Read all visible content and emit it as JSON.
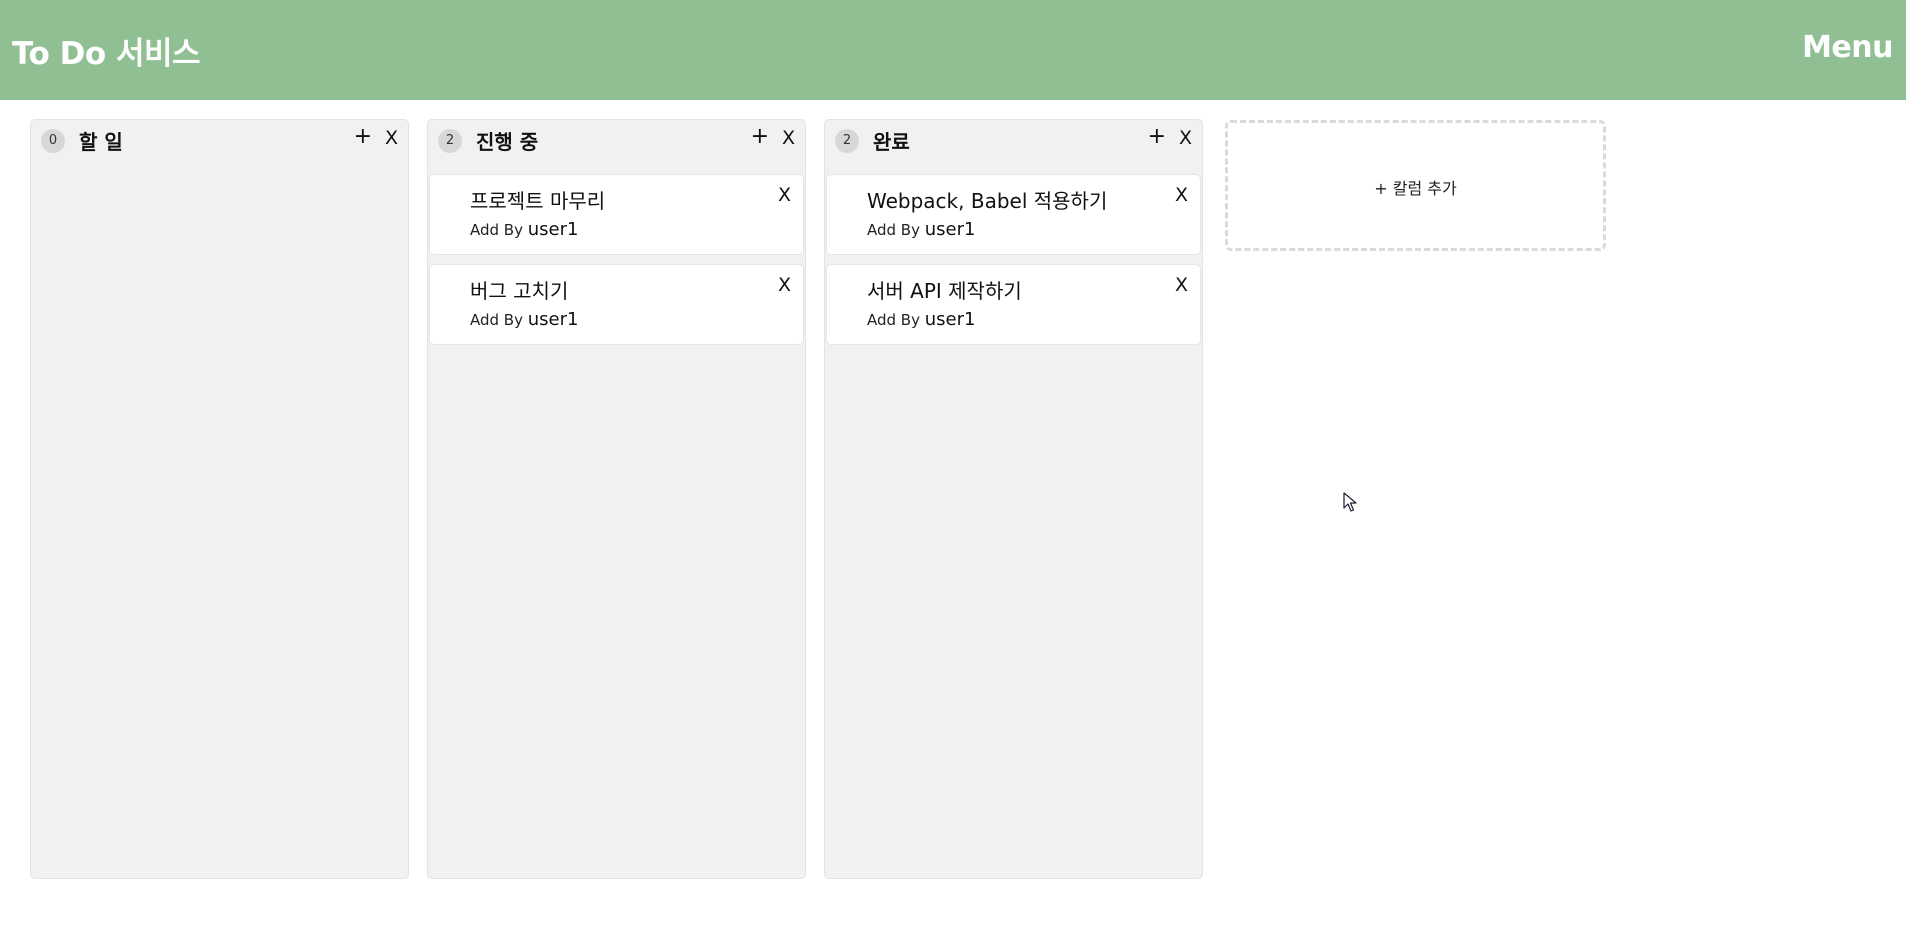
{
  "header": {
    "title": "To Do 서비스",
    "menu_label": "Menu",
    "background_color": "#91bf94"
  },
  "columns": [
    {
      "title": "할 일",
      "count": "0",
      "add_label": "+",
      "close_label": "X",
      "cards": []
    },
    {
      "title": "진행 중",
      "count": "2",
      "add_label": "+",
      "close_label": "X",
      "cards": [
        {
          "title": "프로젝트 마무리",
          "author_prefix": "Add By",
          "author": "user1",
          "close_label": "X"
        },
        {
          "title": "버그 고치기",
          "author_prefix": "Add By",
          "author": "user1",
          "close_label": "X"
        }
      ]
    },
    {
      "title": "완료",
      "count": "2",
      "add_label": "+",
      "close_label": "X",
      "cards": [
        {
          "title": "Webpack, Babel 적용하기",
          "author_prefix": "Add By",
          "author": "user1",
          "close_label": "X"
        },
        {
          "title": "서버 API 제작하기",
          "author_prefix": "Add By",
          "author": "user1",
          "close_label": "X"
        }
      ]
    }
  ],
  "add_column": {
    "label": "+ 칼럼 추가"
  }
}
